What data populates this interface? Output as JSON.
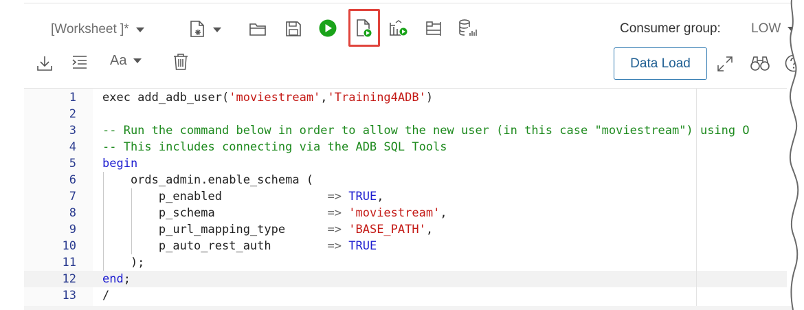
{
  "toolbar": {
    "worksheet_label": "[Worksheet ]*",
    "consumer_group_label": "Consumer group:",
    "consumer_group_value": "LOW",
    "data_load_label": "Data Load",
    "font_menu_label": "Aa",
    "icons": [
      "new-file-icon",
      "open-folder-icon",
      "save-icon",
      "run-statement-icon",
      "run-script-icon",
      "explain-plan-icon",
      "autotrace-icon",
      "sql-tuning-icon",
      "download-icon",
      "format-icon",
      "font-size-icon",
      "trash-icon",
      "expand-icon",
      "binoculars-icon",
      "help-icon"
    ],
    "highlight_color": "#e0443c",
    "run_color": "#1aa31a"
  },
  "editor": {
    "lines": [
      {
        "n": "1",
        "segments": [
          {
            "t": "exec add_adb_user(",
            "c": "plain"
          },
          {
            "t": "'moviestream'",
            "c": "s"
          },
          {
            "t": ",",
            "c": "plain"
          },
          {
            "t": "'Training4ADB'",
            "c": "s"
          },
          {
            "t": ")",
            "c": "plain"
          }
        ]
      },
      {
        "n": "2",
        "segments": []
      },
      {
        "n": "3",
        "segments": [
          {
            "t": "-- Run the command below in order to allow the new user (in this case \"moviestream\") using O",
            "c": "c"
          }
        ]
      },
      {
        "n": "4",
        "segments": [
          {
            "t": "-- This includes connecting via the ADB SQL Tools",
            "c": "c"
          }
        ]
      },
      {
        "n": "5",
        "segments": [
          {
            "t": "begin",
            "c": "k"
          }
        ]
      },
      {
        "n": "6",
        "segments": [
          {
            "t": "    ords_admin.enable_schema (",
            "c": "plain"
          }
        ]
      },
      {
        "n": "7",
        "segments": [
          {
            "t": "        p_enabled               ",
            "c": "plain"
          },
          {
            "t": "=>",
            "c": "o"
          },
          {
            "t": " ",
            "c": "plain"
          },
          {
            "t": "TRUE",
            "c": "k"
          },
          {
            "t": ",",
            "c": "plain"
          }
        ]
      },
      {
        "n": "8",
        "segments": [
          {
            "t": "        p_schema                ",
            "c": "plain"
          },
          {
            "t": "=>",
            "c": "o"
          },
          {
            "t": " ",
            "c": "plain"
          },
          {
            "t": "'moviestream'",
            "c": "s"
          },
          {
            "t": ",",
            "c": "plain"
          }
        ]
      },
      {
        "n": "9",
        "segments": [
          {
            "t": "        p_url_mapping_type      ",
            "c": "plain"
          },
          {
            "t": "=>",
            "c": "o"
          },
          {
            "t": " ",
            "c": "plain"
          },
          {
            "t": "'BASE_PATH'",
            "c": "s"
          },
          {
            "t": ",",
            "c": "plain"
          }
        ]
      },
      {
        "n": "10",
        "segments": [
          {
            "t": "        p_auto_rest_auth        ",
            "c": "plain"
          },
          {
            "t": "=>",
            "c": "o"
          },
          {
            "t": " ",
            "c": "plain"
          },
          {
            "t": "TRUE",
            "c": "k"
          }
        ]
      },
      {
        "n": "11",
        "segments": [
          {
            "t": "    );",
            "c": "plain"
          }
        ]
      },
      {
        "n": "12",
        "segments": [
          {
            "t": "end",
            "c": "k"
          },
          {
            "t": ";",
            "c": "plain"
          }
        ]
      },
      {
        "n": "13",
        "segments": [
          {
            "t": "/",
            "c": "plain"
          }
        ]
      }
    ]
  }
}
